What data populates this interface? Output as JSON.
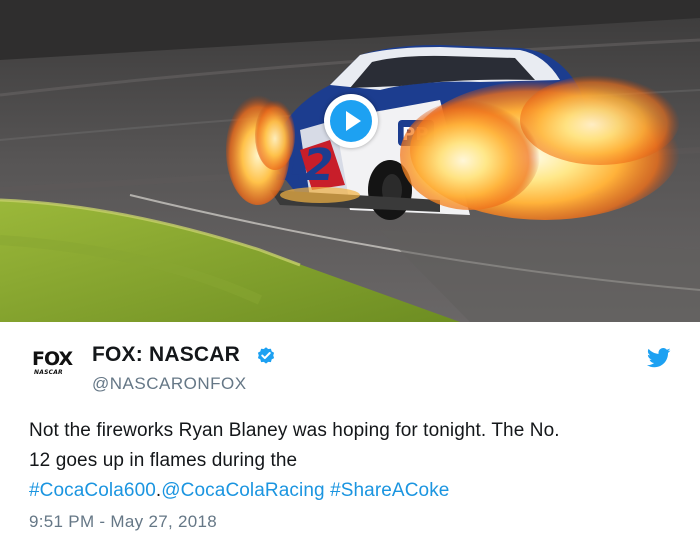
{
  "media": {
    "type": "video",
    "play_icon": "play-icon",
    "car_number": "12"
  },
  "author": {
    "logo_text": "FOX",
    "logo_subtext": "NASCAR",
    "display_name": "FOX: NASCAR",
    "verified_icon": "verified-badge-icon",
    "handle": "@NASCARONFOX"
  },
  "brand_icon": "twitter-bird-icon",
  "tweet": {
    "text_line1": "Not the fireworks Ryan Blaney was hoping for tonight. The No.",
    "text_line2": "12 goes up in flames during the",
    "hashtag1": "#CocaCola600",
    "separator": ".",
    "mention": "@CocaColaRacing",
    "hashtag2": "#ShareACoke",
    "timestamp": "9:51 PM - May 27, 2018"
  },
  "colors": {
    "link": "#1b95e0",
    "twitter_blue": "#1da1f2",
    "text": "#14171a",
    "muted": "#657786"
  }
}
